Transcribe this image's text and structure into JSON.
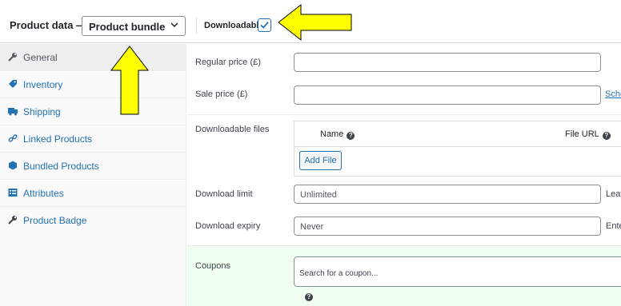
{
  "header": {
    "title": "Product data —",
    "product_type": "Product bundle",
    "downloadable_label": "Downloadable:",
    "downloadable_checked": true
  },
  "sidebar": {
    "items": [
      {
        "label": "General",
        "icon": "wrench-icon",
        "active": true
      },
      {
        "label": "Inventory",
        "icon": "tag-icon",
        "active": false
      },
      {
        "label": "Shipping",
        "icon": "truck-icon",
        "active": false
      },
      {
        "label": "Linked Products",
        "icon": "link-icon",
        "active": false
      },
      {
        "label": "Bundled Products",
        "icon": "hexagon-icon",
        "active": false
      },
      {
        "label": "Attributes",
        "icon": "list-icon",
        "active": false
      },
      {
        "label": "Product Badge",
        "icon": "wrench-icon",
        "active": false
      }
    ]
  },
  "general": {
    "regular_price_label": "Regular price (£)",
    "regular_price_value": "",
    "sale_price_label": "Sale price (£)",
    "sale_price_value": "",
    "schedule_link": "Sche",
    "downloadable_files_label": "Downloadable files",
    "files_col_name": "Name",
    "files_col_url": "File URL",
    "add_file_label": "Add File",
    "download_limit_label": "Download limit",
    "download_limit_placeholder": "Unlimited",
    "download_limit_hint": "Leav",
    "download_expiry_label": "Download expiry",
    "download_expiry_placeholder": "Never",
    "download_expiry_hint": "Ente",
    "coupons_label": "Coupons",
    "coupons_placeholder": "Search for a coupon..."
  },
  "colors": {
    "accent": "#2271b1",
    "annotation_arrow_fill": "#ffff00",
    "coupons_bg": "#f0fff0"
  }
}
